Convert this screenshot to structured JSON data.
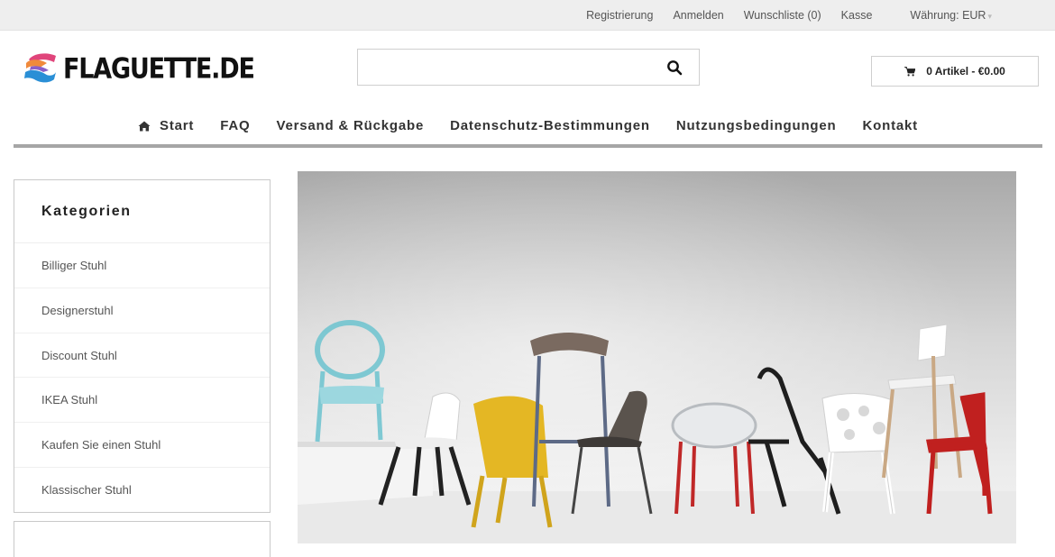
{
  "topbar": {
    "links": [
      "Registrierung",
      "Anmelden",
      "Wunschliste (0)",
      "Kasse"
    ],
    "currency": "Währung: EUR"
  },
  "header": {
    "logo_text": "FLAGUETTE.DE",
    "search": {
      "value": "",
      "placeholder": ""
    },
    "cart_label": "0 Artikel - €0.00"
  },
  "nav": {
    "home": "Start",
    "items": [
      "FAQ",
      "Versand & Rückgabe",
      "Datenschutz-Bestimmungen",
      "Nutzungsbedingungen",
      "Kontakt"
    ]
  },
  "sidebar": {
    "title": "Kategorien",
    "items": [
      "Billiger Stuhl",
      "Designerstuhl",
      "Discount Stuhl",
      "IKEA Stuhl",
      "Kaufen Sie einen Stuhl",
      "Klassischer Stuhl"
    ]
  },
  "colors": {
    "topbar_bg": "#eeeeee",
    "nav_underline": "#a6a6a6",
    "logo_pink": "#e0457b",
    "logo_blue": "#2a8fd6",
    "logo_orange": "#f08a3c"
  },
  "icons": {
    "search": "magnifier-icon",
    "cart": "shopping-cart-icon",
    "home": "home-icon"
  }
}
